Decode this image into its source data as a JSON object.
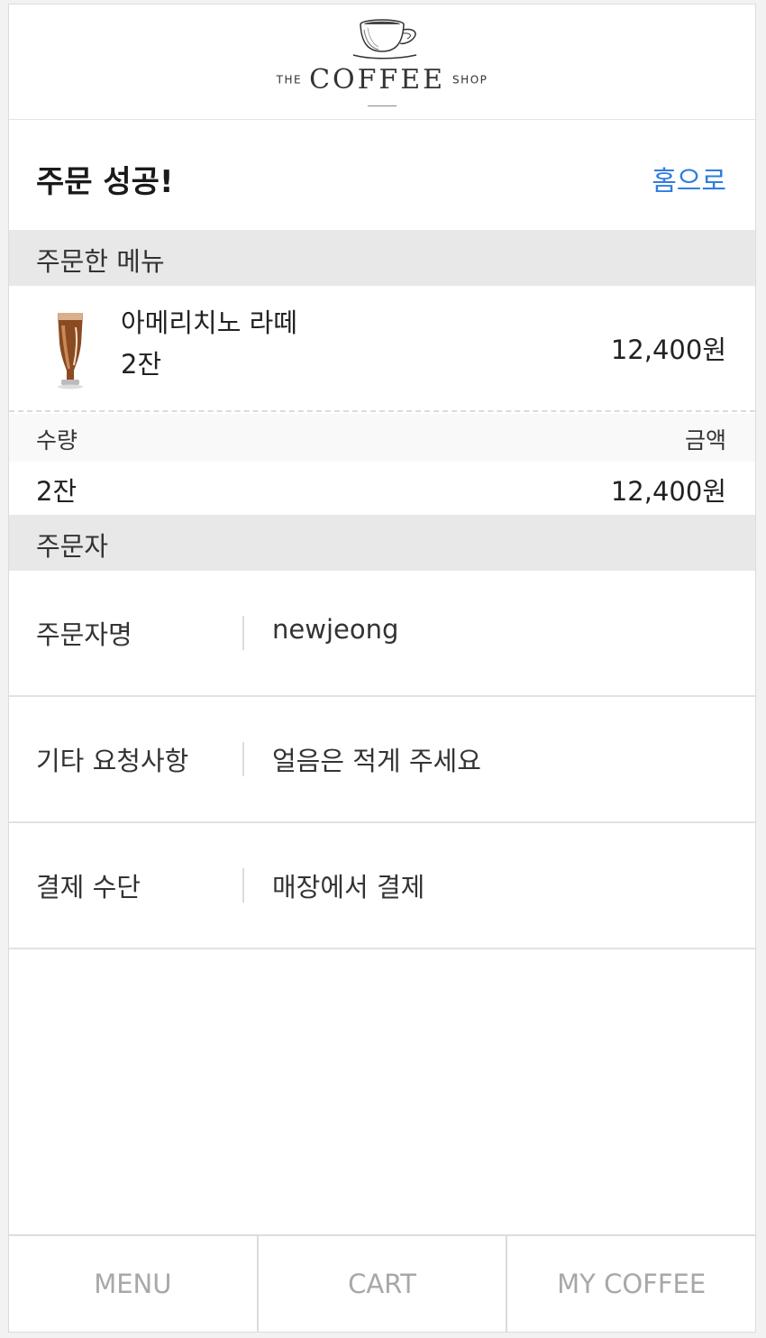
{
  "header": {
    "logo_small_left": "THE",
    "logo_big": "COFFEE",
    "logo_small_right": "SHOP"
  },
  "page": {
    "title": "주문 성공!",
    "home_link": "홈으로"
  },
  "ordered_menu": {
    "section_title": "주문한 메뉴",
    "items": [
      {
        "name": "아메리치노 라떼",
        "quantity": "2잔",
        "price": "12,400원"
      }
    ]
  },
  "summary": {
    "quantity_label": "수량",
    "amount_label": "금액",
    "quantity_value": "2잔",
    "amount_value": "12,400원"
  },
  "orderer": {
    "section_title": "주문자",
    "rows": [
      {
        "label": "주문자명",
        "value": "newjeong"
      },
      {
        "label": "기타 요청사항",
        "value": "얼음은 적게 주세요"
      },
      {
        "label": "결제 수단",
        "value": "매장에서 결제"
      }
    ]
  },
  "tabbar": {
    "tabs": [
      "MENU",
      "CART",
      "MY COFFEE"
    ]
  },
  "colors": {
    "accent": "#2f7de1",
    "section_bg": "#e8e8e8",
    "tab_text": "#a8a8a8"
  }
}
